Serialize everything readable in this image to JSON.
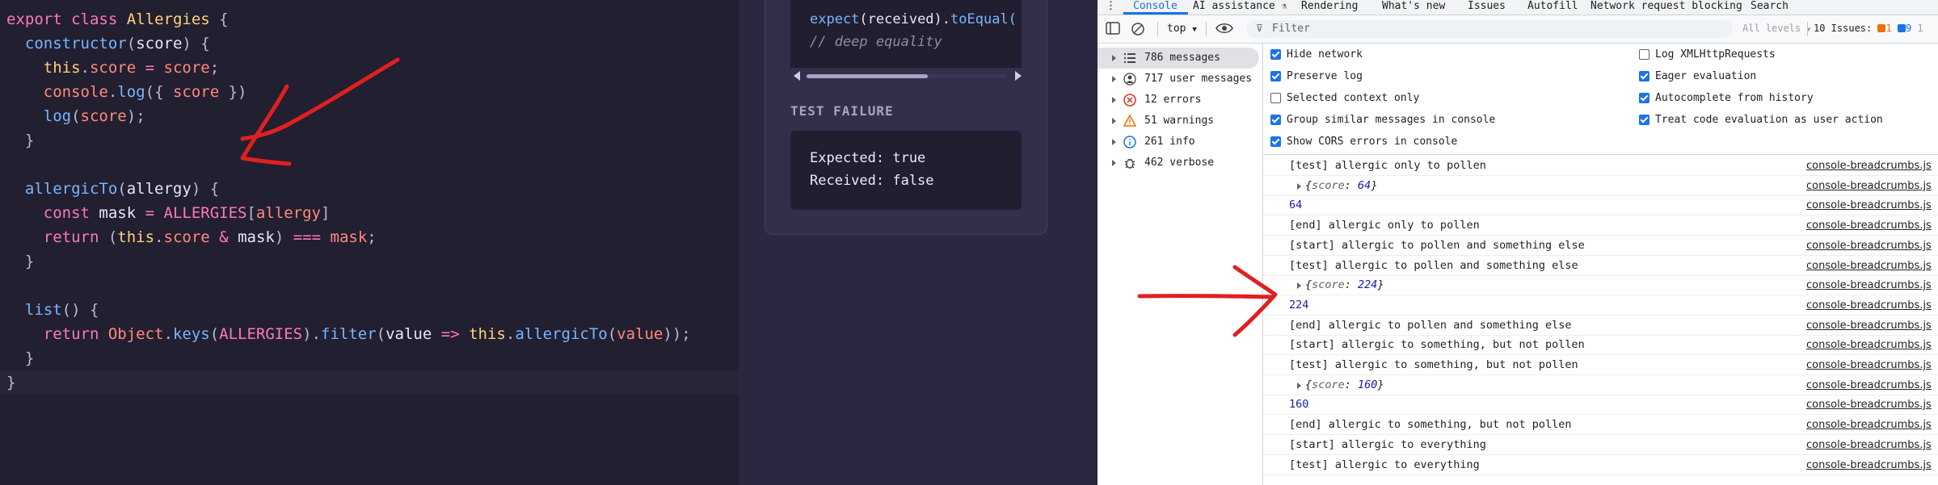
{
  "editor": {
    "lines": [
      [
        [
          "kw",
          "export"
        ],
        [
          "id",
          " "
        ],
        [
          "kw",
          "class"
        ],
        [
          "id",
          " "
        ],
        [
          "cls",
          "Allergies"
        ],
        [
          "pun",
          " {"
        ]
      ],
      [
        [
          "id",
          "  "
        ],
        [
          "fn",
          "constructor"
        ],
        [
          "pun",
          "("
        ],
        [
          "id",
          "score"
        ],
        [
          "pun",
          ") {"
        ]
      ],
      [
        [
          "id",
          "    "
        ],
        [
          "this",
          "this"
        ],
        [
          "pun",
          "."
        ],
        [
          "prop",
          "score"
        ],
        [
          "id",
          " "
        ],
        [
          "op",
          "="
        ],
        [
          "id",
          " "
        ],
        [
          "prop",
          "score"
        ],
        [
          "pun",
          ";"
        ]
      ],
      [
        [
          "id",
          "    "
        ],
        [
          "prop",
          "console"
        ],
        [
          "pun",
          "."
        ],
        [
          "fn",
          "log"
        ],
        [
          "pun",
          "({ "
        ],
        [
          "prop",
          "score"
        ],
        [
          "pun",
          " })"
        ]
      ],
      [
        [
          "id",
          "    "
        ],
        [
          "fn",
          "log"
        ],
        [
          "pun",
          "("
        ],
        [
          "prop",
          "score"
        ],
        [
          "pun",
          ");"
        ]
      ],
      [
        [
          "pun",
          "  }"
        ]
      ],
      [
        [
          "id",
          ""
        ]
      ],
      [
        [
          "id",
          "  "
        ],
        [
          "fn",
          "allergicTo"
        ],
        [
          "pun",
          "("
        ],
        [
          "id",
          "allergy"
        ],
        [
          "pun",
          ") {"
        ]
      ],
      [
        [
          "id",
          "    "
        ],
        [
          "kw",
          "const"
        ],
        [
          "id",
          " mask "
        ],
        [
          "op",
          "="
        ],
        [
          "id",
          " "
        ],
        [
          "const",
          "ALLERGIES"
        ],
        [
          "pun",
          "["
        ],
        [
          "prop",
          "allergy"
        ],
        [
          "pun",
          "]"
        ]
      ],
      [
        [
          "id",
          "    "
        ],
        [
          "kw",
          "return"
        ],
        [
          "pun",
          " ("
        ],
        [
          "this",
          "this"
        ],
        [
          "pun",
          "."
        ],
        [
          "prop",
          "score"
        ],
        [
          "id",
          " "
        ],
        [
          "op",
          "&"
        ],
        [
          "id",
          " mask"
        ],
        [
          "pun",
          ") "
        ],
        [
          "op",
          "==="
        ],
        [
          "id",
          " "
        ],
        [
          "prop",
          "mask"
        ],
        [
          "pun",
          ";"
        ]
      ],
      [
        [
          "pun",
          "  }"
        ]
      ],
      [
        [
          "id",
          ""
        ]
      ],
      [
        [
          "id",
          "  "
        ],
        [
          "fn",
          "list"
        ],
        [
          "pun",
          "() {"
        ]
      ],
      [
        [
          "id",
          "    "
        ],
        [
          "kw",
          "return"
        ],
        [
          "id",
          " "
        ],
        [
          "prop",
          "Object"
        ],
        [
          "pun",
          "."
        ],
        [
          "fn",
          "keys"
        ],
        [
          "pun",
          "("
        ],
        [
          "const",
          "ALLERGIES"
        ],
        [
          "pun",
          ")."
        ],
        [
          "fn",
          "filter"
        ],
        [
          "pun",
          "("
        ],
        [
          "id",
          "value "
        ],
        [
          "op",
          "=>"
        ],
        [
          "id",
          " "
        ],
        [
          "this",
          "this"
        ],
        [
          "pun",
          "."
        ],
        [
          "fn",
          "allergicTo"
        ],
        [
          "pun",
          "("
        ],
        [
          "prop",
          "value"
        ],
        [
          "pun",
          "));"
        ]
      ],
      [
        [
          "pun",
          "  }"
        ]
      ],
      [
        [
          "pun",
          "}"
        ]
      ]
    ]
  },
  "test_panel": {
    "snippet_line1_fn": "expect",
    "snippet_line1_rest": "(received).",
    "snippet_line1_method": "toEqual(",
    "snippet_line2": "// deep equality",
    "failure_title": "TEST FAILURE",
    "expected": "Expected: true",
    "received": "Received: false"
  },
  "devtools": {
    "tabs": [
      "Console",
      "AI assistance",
      "Rendering",
      "What's new",
      "Issues",
      "Autofill",
      "Network request blocking",
      "Search"
    ],
    "context": "top",
    "filter_placeholder": "Filter",
    "levels": "All levels",
    "issues_label": "10 Issues:",
    "issues_errors": "1",
    "issues_info": "9",
    "issues_extra": "1",
    "sidebar": [
      {
        "label": "786 messages",
        "icon": "list-icon",
        "selected": true
      },
      {
        "label": "717 user messages",
        "icon": "user-icon",
        "selected": false
      },
      {
        "label": "12 errors",
        "icon": "error-icon",
        "selected": false
      },
      {
        "label": "51 warnings",
        "icon": "warning-icon",
        "selected": false
      },
      {
        "label": "261 info",
        "icon": "info-icon",
        "selected": false
      },
      {
        "label": "462 verbose",
        "icon": "bug-icon",
        "selected": false
      }
    ],
    "settings_left": [
      {
        "label": "Hide network",
        "checked": true
      },
      {
        "label": "Preserve log",
        "checked": true
      },
      {
        "label": "Selected context only",
        "checked": false
      },
      {
        "label": "Group similar messages in console",
        "checked": true
      },
      {
        "label": "Show CORS errors in console",
        "checked": true
      }
    ],
    "settings_right": [
      {
        "label": "Log XMLHttpRequests",
        "checked": false
      },
      {
        "label": "Eager evaluation",
        "checked": true
      },
      {
        "label": "Autocomplete from history",
        "checked": true
      },
      {
        "label": "Treat code evaluation as user action",
        "checked": true
      }
    ],
    "source_link": "console-breadcrumbs.js",
    "log": [
      {
        "kind": "text",
        "text": "[test] allergic only to pollen"
      },
      {
        "kind": "obj",
        "key": "score",
        "value": "64"
      },
      {
        "kind": "num",
        "text": "64"
      },
      {
        "kind": "text",
        "text": "[end] allergic only to pollen"
      },
      {
        "kind": "text",
        "text": "[start] allergic to pollen and something else"
      },
      {
        "kind": "text",
        "text": "[test] allergic to pollen and something else"
      },
      {
        "kind": "obj",
        "key": "score",
        "value": "224"
      },
      {
        "kind": "num",
        "text": "224"
      },
      {
        "kind": "text",
        "text": "[end] allergic to pollen and something else"
      },
      {
        "kind": "text",
        "text": "[start] allergic to something, but not pollen"
      },
      {
        "kind": "text",
        "text": "[test] allergic to something, but not pollen"
      },
      {
        "kind": "obj",
        "key": "score",
        "value": "160"
      },
      {
        "kind": "num",
        "text": "160"
      },
      {
        "kind": "text",
        "text": "[end] allergic to something, but not pollen"
      },
      {
        "kind": "text",
        "text": "[start] allergic to everything"
      },
      {
        "kind": "text",
        "text": "[test] allergic to everything"
      }
    ]
  },
  "colors": {
    "annotation": "#e02020",
    "accent": "#1a73e8"
  }
}
